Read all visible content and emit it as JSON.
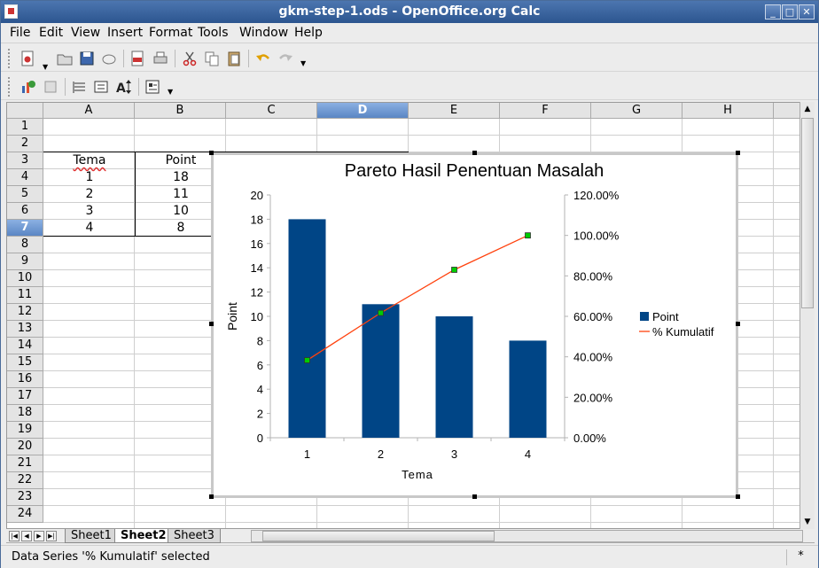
{
  "window": {
    "title": "gkm-step-1.ods - OpenOffice.org Calc",
    "buttons": [
      "_",
      "□",
      "✕"
    ]
  },
  "menubar": {
    "items": [
      "File",
      "Edit",
      "View",
      "Insert",
      "Format",
      "Tools",
      "Window",
      "Help"
    ]
  },
  "toolbar1": {
    "icons": [
      "new-icon",
      "open-icon",
      "save-icon",
      "email-icon",
      "pdf-icon",
      "print-icon",
      "cut-icon",
      "copy-icon",
      "paste-icon",
      "undo-icon",
      "redo-icon"
    ]
  },
  "toolbar2": {
    "icons": [
      "chart-type-icon",
      "chart-data-table-icon",
      "horizontal-grids-icon",
      "legend-icon",
      "scale-text-icon",
      "autolayout-icon"
    ]
  },
  "columns": [
    "A",
    "B",
    "C",
    "D",
    "E",
    "F",
    "G",
    "H"
  ],
  "selected_column": "D",
  "rows": [
    "1",
    "2",
    "3",
    "4",
    "5",
    "6",
    "7",
    "8",
    "9",
    "10",
    "11",
    "12",
    "13",
    "14",
    "15",
    "16",
    "17",
    "18",
    "19",
    "20",
    "21",
    "22",
    "23",
    "24"
  ],
  "selected_row": "7",
  "table": {
    "headers": [
      "Tema",
      "Point"
    ],
    "rows": [
      [
        "1",
        "18"
      ],
      [
        "2",
        "11"
      ],
      [
        "3",
        "10"
      ],
      [
        "4",
        "8"
      ]
    ]
  },
  "chart_data": {
    "type": "bar",
    "title": "Pareto Hasil Penentuan Masalah",
    "categories": [
      "1",
      "2",
      "3",
      "4"
    ],
    "xlabel": "Tema",
    "ylabel": "Point",
    "ylim": [
      0,
      20
    ],
    "yticks": [
      "0",
      "2",
      "4",
      "6",
      "8",
      "10",
      "12",
      "14",
      "16",
      "18",
      "20"
    ],
    "y2lim": [
      0,
      1.2
    ],
    "y2ticks": [
      "0.00%",
      "20.00%",
      "40.00%",
      "60.00%",
      "80.00%",
      "100.00%",
      "120.00%"
    ],
    "series": [
      {
        "name": "Point",
        "type": "bar",
        "values": [
          18,
          11,
          10,
          8
        ],
        "color": "#004586"
      },
      {
        "name": "% Kumulatif",
        "type": "line",
        "axis": "secondary",
        "values": [
          0.383,
          0.617,
          0.83,
          1.0
        ],
        "color": "#ff420e",
        "marker_color": "#00cc00"
      }
    ],
    "legend": "right",
    "grid": false
  },
  "sheet_tabs": {
    "tabs": [
      "Sheet1",
      "Sheet2",
      "Sheet3"
    ],
    "active": "Sheet2"
  },
  "status": {
    "message": "Data Series '% Kumulatif' selected",
    "modified_marker": "*"
  }
}
